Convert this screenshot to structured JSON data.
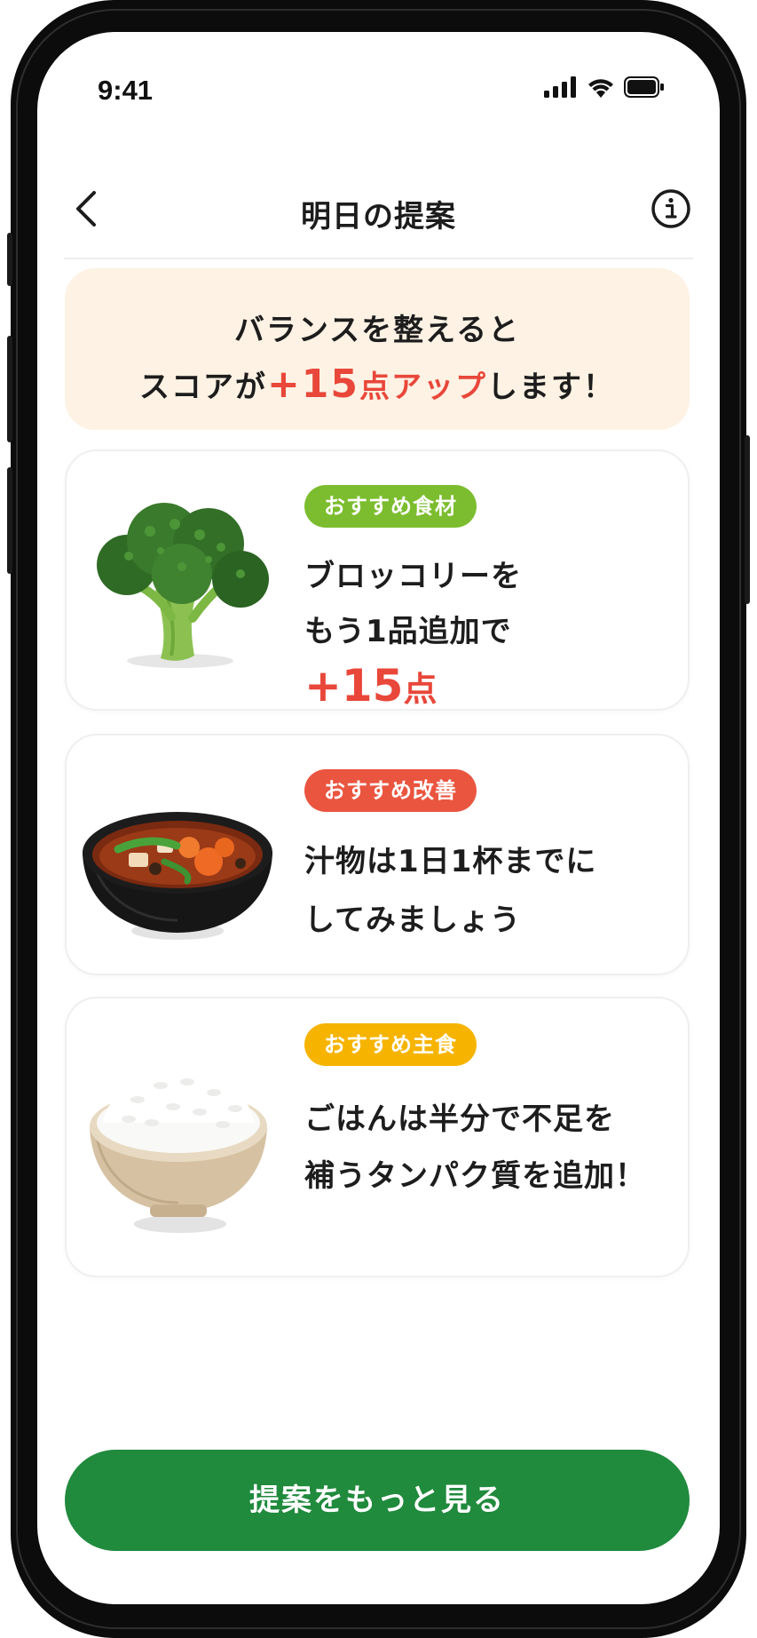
{
  "status_bar": {
    "time": "9:41"
  },
  "header": {
    "title": "明日の提案",
    "back_icon": "chevron-left-icon",
    "info_icon": "info-icon"
  },
  "banner": {
    "line1": "バランスを整えると",
    "line2_prefix": "スコアが",
    "line2_points": "+15",
    "line2_points_suffix": "点アップ",
    "line2_suffix": "します！"
  },
  "cards": [
    {
      "badge": "おすすめ食材",
      "badge_color": "#7cbd2f",
      "image": "broccoli",
      "line1": "ブロッコリーを",
      "line2": "もう1品追加で",
      "points": "+15",
      "points_unit": "点"
    },
    {
      "badge": "おすすめ改善",
      "badge_color": "#ea5540",
      "image": "miso-soup",
      "line1": "汁物は1日1杯までに",
      "line2": "してみましょう"
    },
    {
      "badge": "おすすめ主食",
      "badge_color": "#f6b400",
      "image": "rice-bowl",
      "line1": "ごはんは半分で不足を",
      "line2": "補うタンパク質を追加！"
    }
  ],
  "cta": {
    "label": "提案をもっと見る",
    "color": "#208a3d"
  }
}
